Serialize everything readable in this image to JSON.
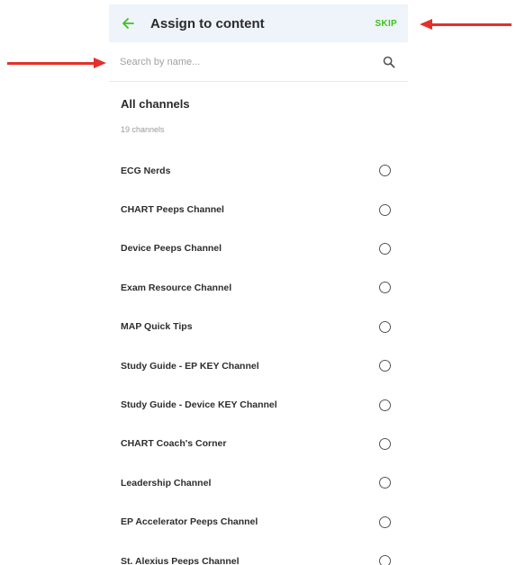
{
  "header": {
    "title": "Assign to content",
    "skip_label": "SKIP",
    "back_icon": "arrow-left-icon",
    "accent_color": "#3cc21b"
  },
  "search": {
    "placeholder": "Search by name...",
    "value": "",
    "icon": "search-icon"
  },
  "section": {
    "title": "All channels",
    "count_text": "19 channels"
  },
  "channels": [
    {
      "label": "ECG Nerds",
      "selected": false
    },
    {
      "label": "CHART Peeps Channel",
      "selected": false
    },
    {
      "label": "Device Peeps Channel",
      "selected": false
    },
    {
      "label": "Exam Resource Channel",
      "selected": false
    },
    {
      "label": "MAP Quick Tips",
      "selected": false
    },
    {
      "label": "Study Guide - EP KEY Channel",
      "selected": false
    },
    {
      "label": "Study Guide - Device KEY Channel",
      "selected": false
    },
    {
      "label": "CHART Coach's Corner",
      "selected": false
    },
    {
      "label": "Leadership Channel",
      "selected": false
    },
    {
      "label": "EP Accelerator Peeps Channel",
      "selected": false
    },
    {
      "label": "St. Alexius Peeps Channel",
      "selected": false
    }
  ],
  "annotations": {
    "arrow_color": "#e3302b"
  }
}
